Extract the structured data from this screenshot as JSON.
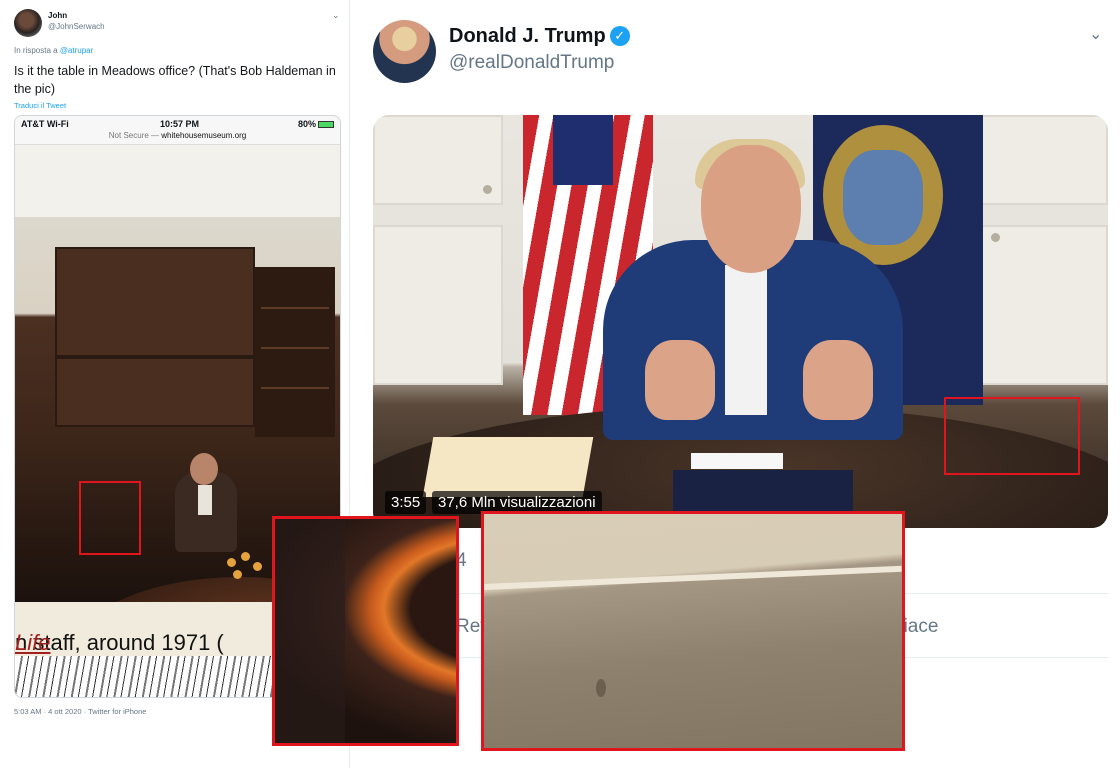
{
  "left_tweet": {
    "display_name": "John",
    "handle": "@JohnSerwach",
    "chevron": "⌄",
    "reply_prefix": "In risposta a",
    "reply_to": "@atrupar",
    "text": "Is it the table in Meadows office? (That's Bob Haldeman in the pic)",
    "translate_label": "Traduci il Tweet",
    "phone": {
      "carrier": "AT&T Wi-Fi",
      "time": "10:57 PM",
      "battery": "80%",
      "url_prefix": "Not Secure —",
      "url": "whitehousemuseum.org",
      "caption": "n staff, around 1971 (",
      "caption_link": "Life"
    },
    "footer": "5:03 AM · 4 ott 2020 · Twitter for iPhone"
  },
  "right_tweet": {
    "display_name": "Donald J. Trump",
    "verified_glyph": "✓",
    "handle": "@realDonaldTrump",
    "chevron": "⌄",
    "video": {
      "duration": "3:55",
      "views": "37,6 Mln visualizzazioni"
    },
    "count_partial": "4",
    "retweet_partial": "Ret",
    "like_partial": "piace"
  },
  "highlight_color": "#e0151d",
  "link_color": "#1da1f2"
}
